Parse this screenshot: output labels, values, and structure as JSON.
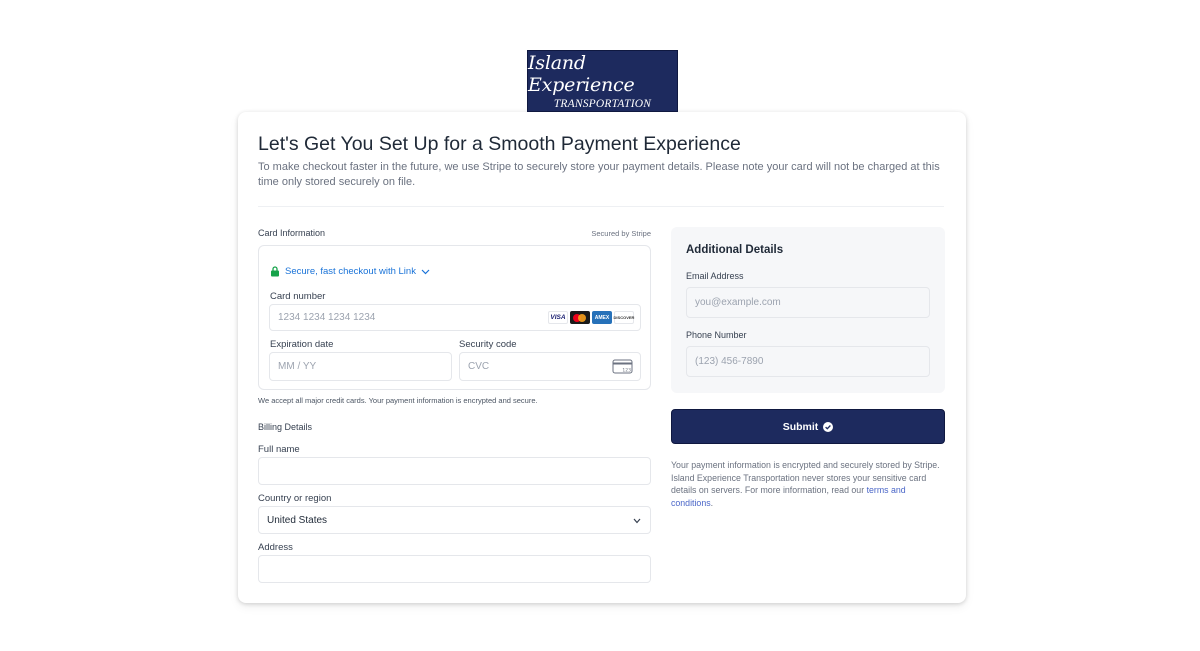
{
  "logo": {
    "line1": "Island Experience",
    "line2": "TRANSPORTATION",
    "bg_color": "#1d2a5e"
  },
  "header": {
    "title": "Let's Get You Set Up for a Smooth Payment Experience",
    "subtitle": "To make checkout faster in the future, we use Stripe to securely store your payment details. Please note your card will not be charged at this time only stored securely on file."
  },
  "card_info": {
    "label": "Card Information",
    "secured": "Secured by Stripe",
    "link_text": "Secure, fast checkout with Link",
    "card_number_label": "Card number",
    "card_number_placeholder": "1234 1234 1234 1234",
    "brands": [
      "VISA",
      "mastercard",
      "AMEX",
      "DISCOVER"
    ],
    "expiry_label": "Expiration date",
    "expiry_placeholder": "MM / YY",
    "cvc_label": "Security code",
    "cvc_placeholder": "CVC",
    "help": "We accept all major credit cards. Your payment information is encrypted and secure."
  },
  "billing": {
    "label": "Billing Details",
    "full_name_label": "Full name",
    "full_name_value": "",
    "country_label": "Country or region",
    "country_value": "United States",
    "address_label": "Address",
    "address_value": ""
  },
  "additional": {
    "title": "Additional Details",
    "email_label": "Email Address",
    "email_placeholder": "you@example.com",
    "phone_label": "Phone Number",
    "phone_placeholder": "(123) 456-7890"
  },
  "submit": {
    "label": "Submit",
    "color": "#1d2a5e"
  },
  "note": {
    "text": "Your payment information is encrypted and securely stored by Stripe. Island Experience Transportation never stores your sensitive card details on servers. For more information, read our ",
    "link": "terms and conditions",
    "end": "."
  },
  "colors": {
    "link": "#1a73d8",
    "link_green_lock": "#16a34a",
    "terms_link": "#4a66c8"
  }
}
